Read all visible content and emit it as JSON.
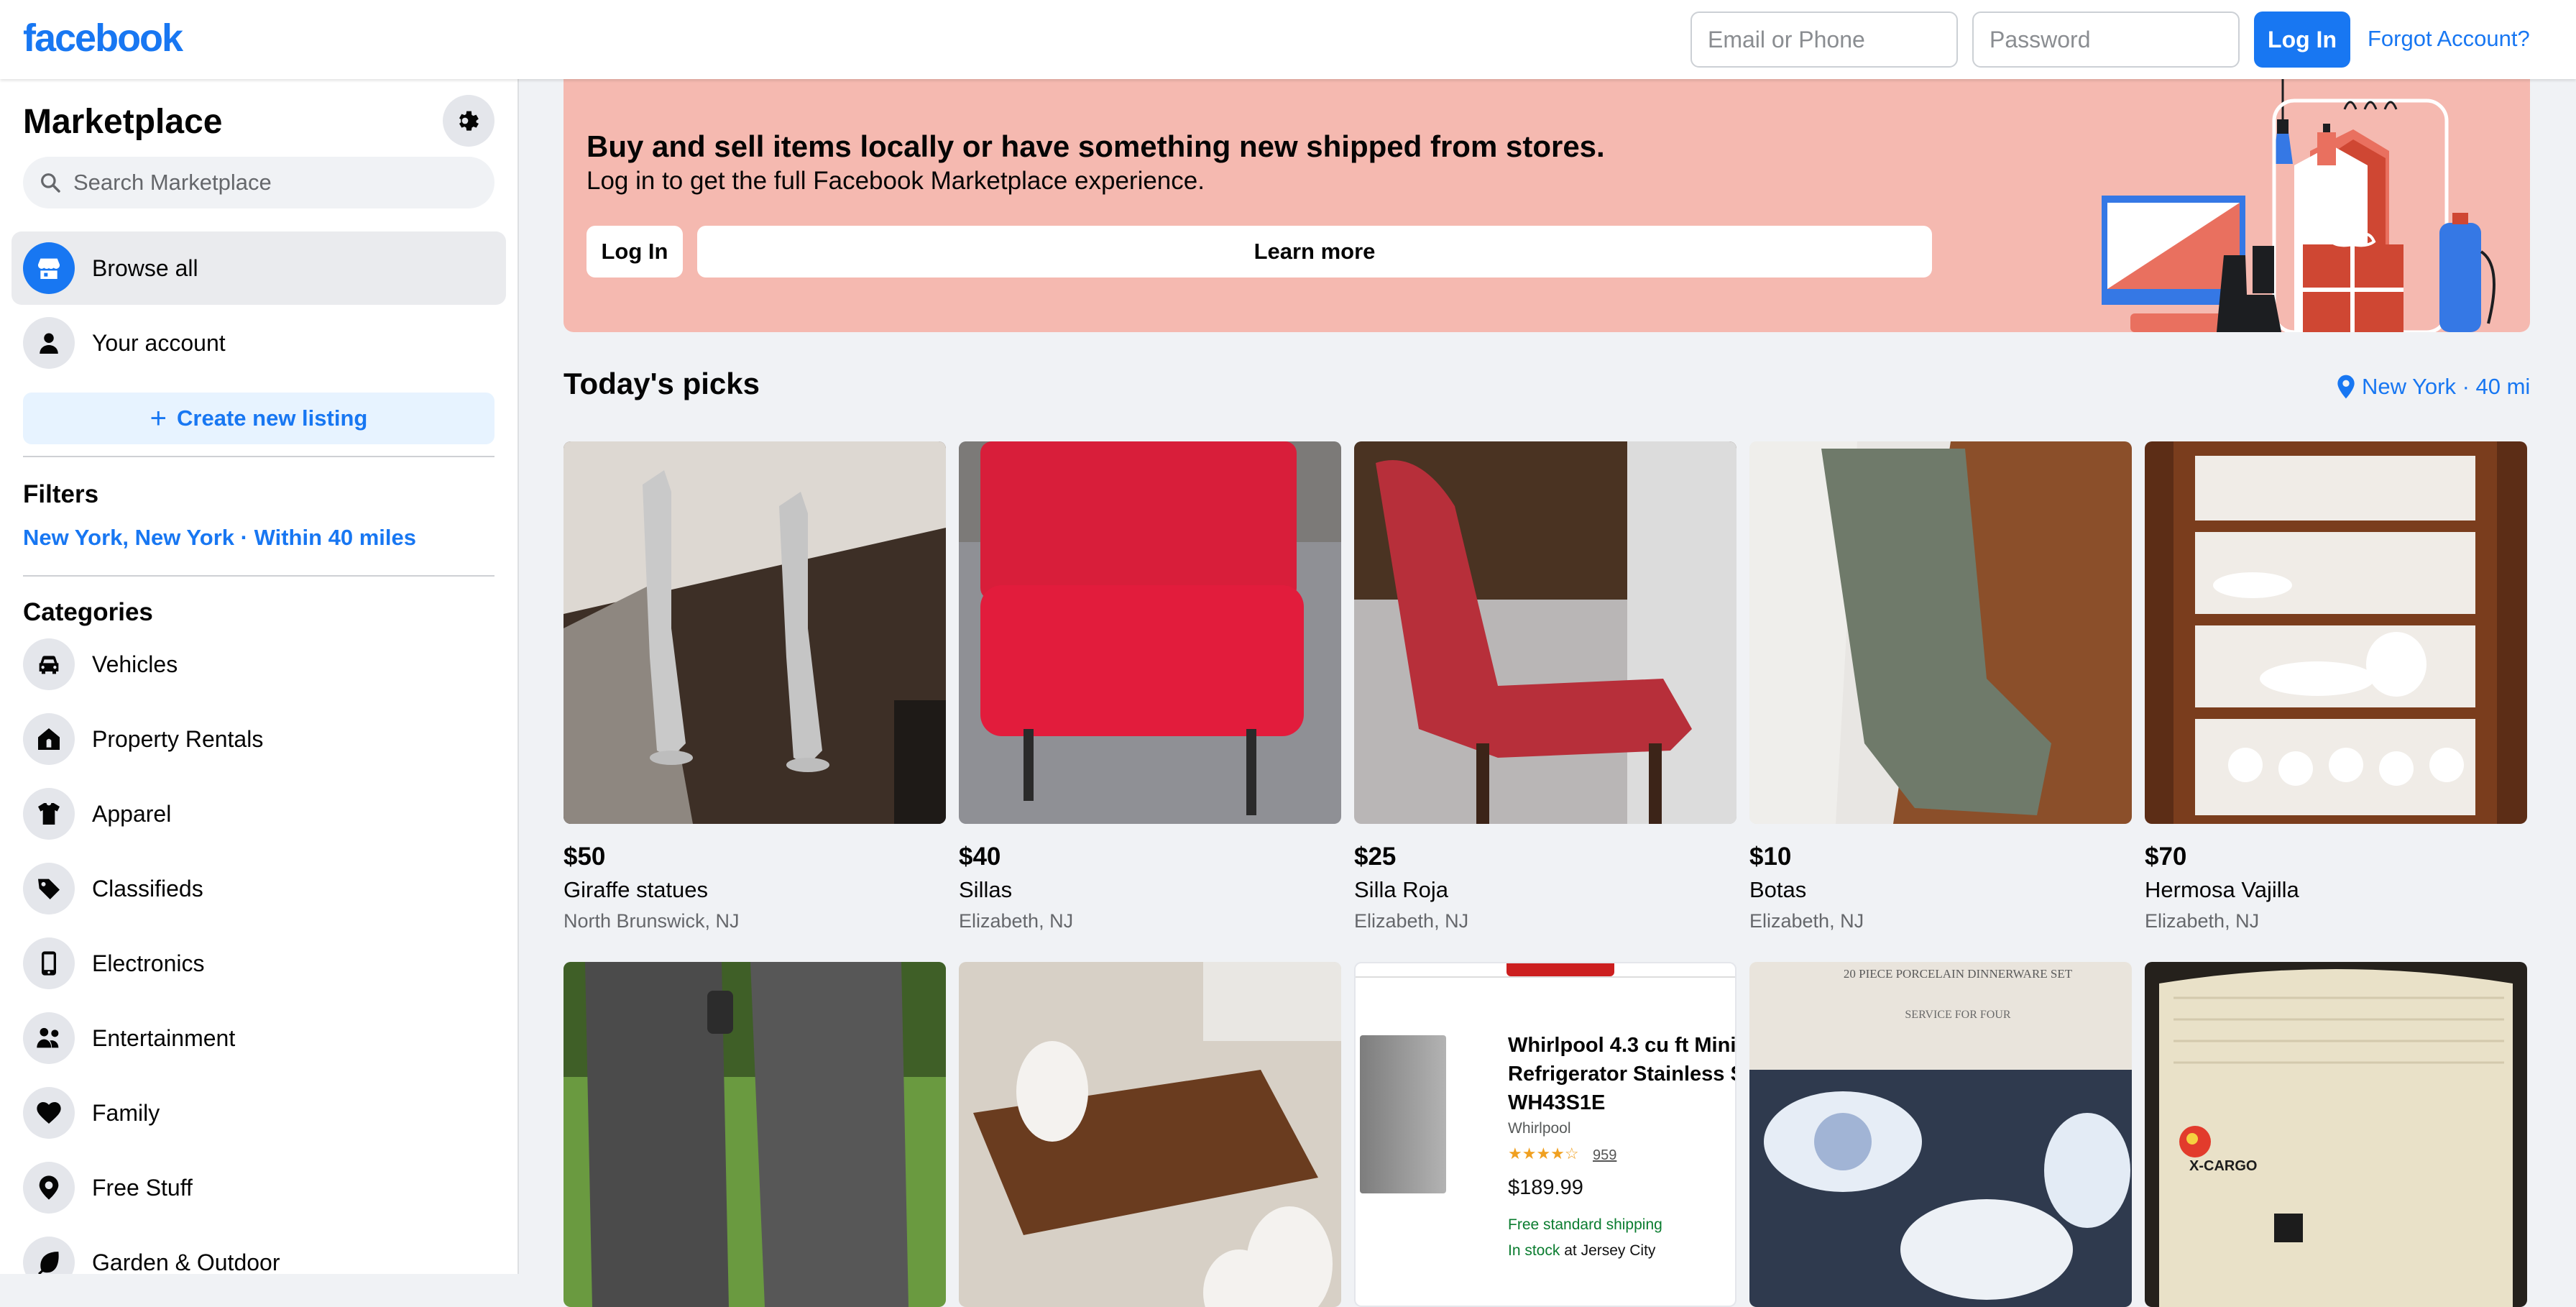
{
  "topbar": {
    "logo": "facebook",
    "email_placeholder": "Email or Phone",
    "password_placeholder": "Password",
    "login_label": "Log In",
    "forgot_label": "Forgot Account?"
  },
  "sidebar": {
    "title": "Marketplace",
    "search_placeholder": "Search Marketplace",
    "nav": [
      {
        "label": "Browse all",
        "icon": "storefront-icon",
        "active": true
      },
      {
        "label": "Your account",
        "icon": "person-icon",
        "active": false
      }
    ],
    "create_listing": "Create new listing",
    "filters_heading": "Filters",
    "filter_location": "New York, New York · Within 40 miles",
    "categories_heading": "Categories",
    "categories": [
      {
        "label": "Vehicles",
        "icon": "car-icon"
      },
      {
        "label": "Property Rentals",
        "icon": "house-icon"
      },
      {
        "label": "Apparel",
        "icon": "shirt-icon"
      },
      {
        "label": "Classifieds",
        "icon": "tag-icon"
      },
      {
        "label": "Electronics",
        "icon": "phone-icon"
      },
      {
        "label": "Entertainment",
        "icon": "people-icon"
      },
      {
        "label": "Family",
        "icon": "heart-icon"
      },
      {
        "label": "Free Stuff",
        "icon": "free-tag-icon"
      },
      {
        "label": "Garden & Outdoor",
        "icon": "leaf-icon"
      }
    ]
  },
  "banner": {
    "heading": "Buy and sell items locally or have something new shipped from stores.",
    "subtext": "Log in to get the full Facebook Marketplace experience.",
    "login_label": "Log In",
    "learn_more_label": "Learn more"
  },
  "picks": {
    "title": "Today's picks",
    "location": "New York · 40 mi",
    "listings": [
      {
        "price": "$50",
        "title": "Giraffe statues",
        "city": "North Brunswick, NJ"
      },
      {
        "price": "$40",
        "title": "Sillas",
        "city": "Elizabeth, NJ"
      },
      {
        "price": "$25",
        "title": "Silla Roja",
        "city": "Elizabeth, NJ"
      },
      {
        "price": "$10",
        "title": "Botas",
        "city": "Elizabeth, NJ"
      },
      {
        "price": "$70",
        "title": "Hermosa Vajilla",
        "city": "Elizabeth, NJ"
      }
    ],
    "row2_product": {
      "title_line1": "Whirlpool 4.3 cu ft Mini",
      "title_line2": "Refrigerator Stainless S",
      "title_line3": "WH43S1E",
      "brand": "Whirlpool",
      "reviews": "959",
      "price": "$189.99",
      "shipping": "Free standard shipping",
      "stock": "In stock",
      "stock_loc": "at Jersey City"
    },
    "row2_box_text": {
      "line1": "20 PIECE PORCELAIN DINNERWARE SET",
      "line2": "SERVICE FOR FOUR"
    },
    "row2_cargo_text": "X-CARGO"
  },
  "colors": {
    "brand": "#1877f2",
    "banner": "#f5b9b0",
    "create_bg": "#e7f3ff"
  }
}
